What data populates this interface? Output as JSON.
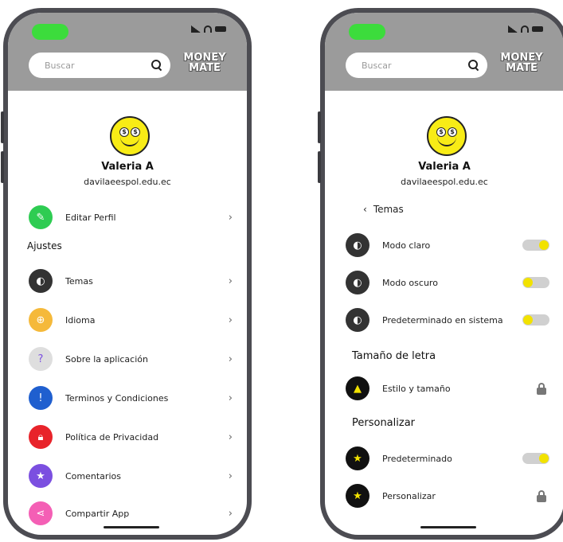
{
  "search": {
    "placeholder": "Buscar"
  },
  "logo": {
    "line1": "MONEY",
    "line2": "MATE"
  },
  "profile": {
    "name": "Valeria A",
    "email": "davilaeespol.edu.ec"
  },
  "left": {
    "edit_profile": "Editar Perfil",
    "settings_title": "Ajustes",
    "items": [
      {
        "label": "Temas",
        "icon": "theme-icon",
        "color": "#333333"
      },
      {
        "label": "Idioma",
        "icon": "globe-icon",
        "color": "#f5b93a"
      },
      {
        "label": "Sobre la aplicación",
        "icon": "question-icon",
        "color": "#dedede"
      },
      {
        "label": "Terminos y Condiciones",
        "icon": "info-icon",
        "color": "#1f5fcf"
      },
      {
        "label": "Política de Privacidad",
        "icon": "lock-icon",
        "color": "#e8232a"
      },
      {
        "label": "Comentarios",
        "icon": "star-icon",
        "color": "#7b4fe0"
      },
      {
        "label": "Compartir App",
        "icon": "share-icon",
        "color": "#f45fb5"
      }
    ],
    "edit_color": "#2ecc52"
  },
  "right": {
    "back_label": "Temas",
    "themes": [
      {
        "label": "Modo claro",
        "on": true
      },
      {
        "label": "Modo oscuro",
        "on": false
      },
      {
        "label": "Predeterminado en sistema",
        "on": false
      }
    ],
    "font_section": "Tamaño de letra",
    "font_item": "Estilo y tamaño",
    "personal_section": "Personalizar",
    "personal_items": [
      {
        "label": "Predeterminado",
        "control": "toggle-on"
      },
      {
        "label": "Personalizar",
        "control": "lock"
      }
    ]
  },
  "colors": {
    "accent_yellow": "#f2e200",
    "topbar": "#9b9b9b"
  }
}
